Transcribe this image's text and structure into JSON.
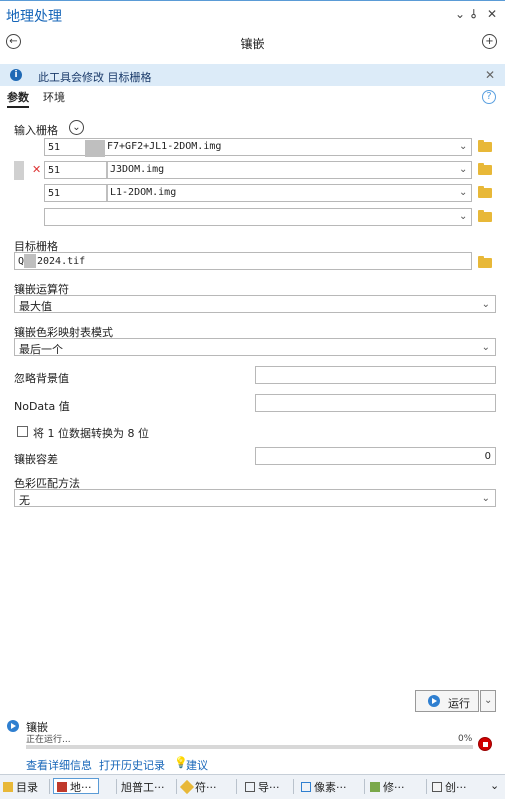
{
  "window": {
    "title": "地理处理",
    "controls": {
      "menu": "⌄",
      "pin": "ꟷ",
      "close": "✕"
    }
  },
  "tool": {
    "name": "镶嵌"
  },
  "info_bar": {
    "text": "此工具会修改 目标栅格"
  },
  "tabs": {
    "params": "参数",
    "env": "环境"
  },
  "input_rasters": {
    "label": "输入栅格",
    "rows": [
      {
        "prefix": "51",
        "suffix": "F7+GF2+JL1-2DOM.img"
      },
      {
        "prefix": "51",
        "suffix": "J3DOM.img"
      },
      {
        "prefix": "51",
        "suffix": "L1-2DOM.img"
      },
      {
        "prefix": "",
        "suffix": ""
      }
    ]
  },
  "target_raster": {
    "label": "目标栅格",
    "value": "Q",
    "suffix": "2024.tif"
  },
  "mosaic_operator": {
    "label": "镶嵌运算符",
    "value": "最大值"
  },
  "colormap_mode": {
    "label": "镶嵌色彩映射表模式",
    "value": "最后一个"
  },
  "ignore_bg": {
    "label": "忽略背景值",
    "value": ""
  },
  "nodata": {
    "label": "NoData 值",
    "value": ""
  },
  "convert_1bit": {
    "label": "将 1 位数据转换为 8 位"
  },
  "tolerance": {
    "label": "镶嵌容差",
    "value": "0"
  },
  "color_match": {
    "label": "色彩匹配方法",
    "value": "无"
  },
  "run": {
    "label": "运行"
  },
  "status": {
    "tool": "镶嵌",
    "state": "正在运行...",
    "percent": "0%",
    "progress": 0
  },
  "links": {
    "details": "查看详细信息",
    "history": "打开历史记录",
    "suggest": "建议"
  },
  "bottom_tabs": [
    "目录",
    "地···",
    "旭普工···",
    "符···",
    "导···",
    "像素···",
    "修···",
    "创···"
  ],
  "colors": {
    "accent": "#1565b8",
    "info_bg": "#dcebf8",
    "stop": "#d10000",
    "folder": "#e8b838"
  }
}
